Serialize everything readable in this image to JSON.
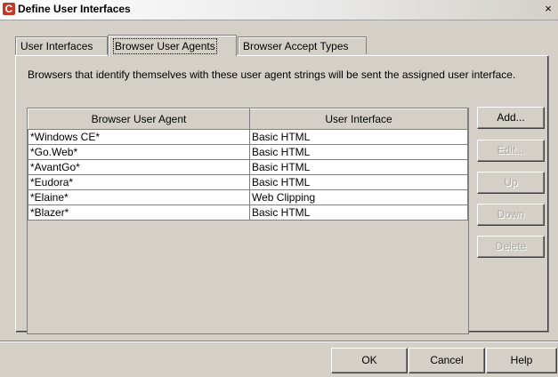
{
  "window": {
    "title": "Define User Interfaces",
    "close_glyph": "×"
  },
  "tabs": [
    {
      "label": "User Interfaces"
    },
    {
      "label": "Browser User Agents"
    },
    {
      "label": "Browser Accept Types"
    }
  ],
  "active_tab": "Browser User Agents",
  "description": "Browsers that identify themselves with these user agent strings will be sent the assigned user interface.",
  "table": {
    "headers": [
      "Browser User Agent",
      "User Interface"
    ],
    "rows": [
      [
        "*Windows CE*",
        "Basic HTML"
      ],
      [
        "*Go.Web*",
        "Basic HTML"
      ],
      [
        "*AvantGo*",
        "Basic HTML"
      ],
      [
        "*Eudora*",
        "Basic HTML"
      ],
      [
        "*Elaine*",
        "Web Clipping"
      ],
      [
        "*Blazer*",
        "Basic HTML"
      ]
    ]
  },
  "side_buttons": {
    "add": "Add...",
    "edit": "Edit...",
    "up": "Up",
    "down": "Down",
    "delete": "Delete"
  },
  "footer_buttons": {
    "ok": "OK",
    "cancel": "Cancel",
    "help": "Help"
  },
  "colors": {
    "dialog_bg": "#d4d0c8",
    "app_icon": "#c0392b",
    "disabled_text": "#a8a6a0"
  },
  "icons": {
    "app": "novell-c-icon",
    "close": "close-icon"
  }
}
